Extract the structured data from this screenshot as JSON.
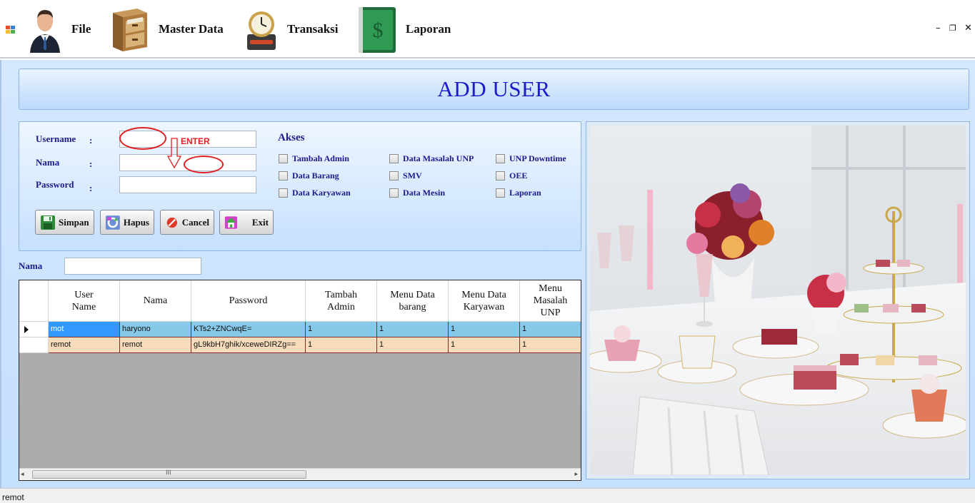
{
  "menubar": {
    "items": [
      {
        "label": "File",
        "icon": "businessman-icon"
      },
      {
        "label": "Master Data",
        "icon": "filing-cabinet-icon"
      },
      {
        "label": "Transaksi",
        "icon": "clock-drive-icon"
      },
      {
        "label": "Laporan",
        "icon": "money-book-icon"
      }
    ],
    "window_controls": {
      "minimize": "–",
      "restore": "❐",
      "close": "✕"
    }
  },
  "page": {
    "title": "ADD USER"
  },
  "form": {
    "username_label": "Username",
    "nama_label": "Nama",
    "password_label": "Password",
    "colon": ":",
    "username_value": "",
    "nama_value": "",
    "password_value": "",
    "annotation_text": "ENTER"
  },
  "akses": {
    "title": "Akses",
    "items": [
      {
        "label": "Tambah Admin",
        "checked": false
      },
      {
        "label": "Data Masalah UNP",
        "checked": false
      },
      {
        "label": "UNP Downtime",
        "checked": false
      },
      {
        "label": "Data Barang",
        "checked": false
      },
      {
        "label": "SMV",
        "checked": false
      },
      {
        "label": "OEE",
        "checked": false
      },
      {
        "label": "Data Karyawan",
        "checked": false
      },
      {
        "label": "Data Mesin",
        "checked": false
      },
      {
        "label": "Laporan",
        "checked": false
      }
    ]
  },
  "buttons": {
    "simpan": "Simpan",
    "hapus": "Hapus",
    "cancel": "Cancel",
    "exit": "Exit"
  },
  "search": {
    "label": "Nama",
    "value": ""
  },
  "grid": {
    "columns": [
      "User\nName",
      "Nama",
      "Password",
      "Tambah\nAdmin",
      "Menu Data\nbarang",
      "Menu Data\nKaryawan",
      "Menu\nMasalah\nUNP"
    ],
    "rows": [
      [
        "mot",
        "haryono",
        "KTs2+ZNCwqE=",
        "1",
        "1",
        "1",
        "1"
      ],
      [
        "remot",
        "remot",
        "gL9kbH7ghik/xceweDIRZg==",
        "1",
        "1",
        "1",
        "1"
      ]
    ],
    "scroll_grip": "III",
    "scroll_left": "◂",
    "scroll_right": "▸"
  },
  "photo": {
    "subject": "dessert-table-photo"
  },
  "statusbar": {
    "text": "remot"
  }
}
